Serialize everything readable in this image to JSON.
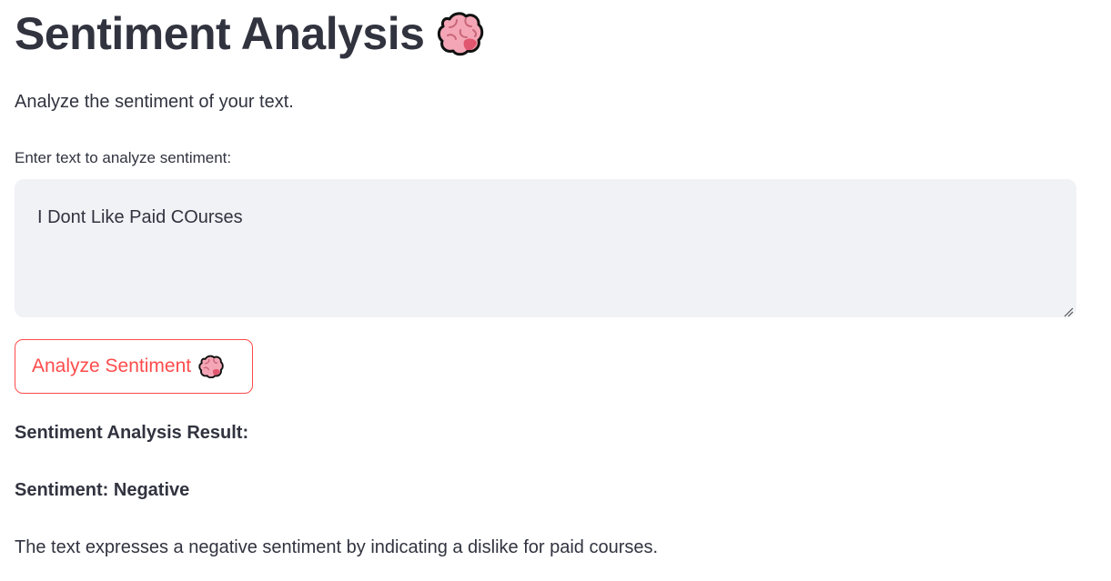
{
  "header": {
    "title": "Sentiment Analysis",
    "title_icon": "brain-icon"
  },
  "subtitle": "Analyze the sentiment of your text.",
  "input": {
    "label": "Enter text to analyze sentiment:",
    "value": "I Dont Like Paid COurses"
  },
  "analyze_button": {
    "label": "Analyze Sentiment",
    "icon": "brain-icon"
  },
  "result": {
    "heading": "Sentiment Analysis Result:",
    "sentiment_line": "Sentiment: Negative",
    "explanation": "The text expresses a negative sentiment by indicating a dislike for paid courses."
  },
  "colors": {
    "text": "#31333F",
    "accent": "#FF4B4B",
    "input_bg": "#F0F2F6",
    "brain_pink": "#F4A6B6",
    "brain_dark": "#E0566E"
  }
}
